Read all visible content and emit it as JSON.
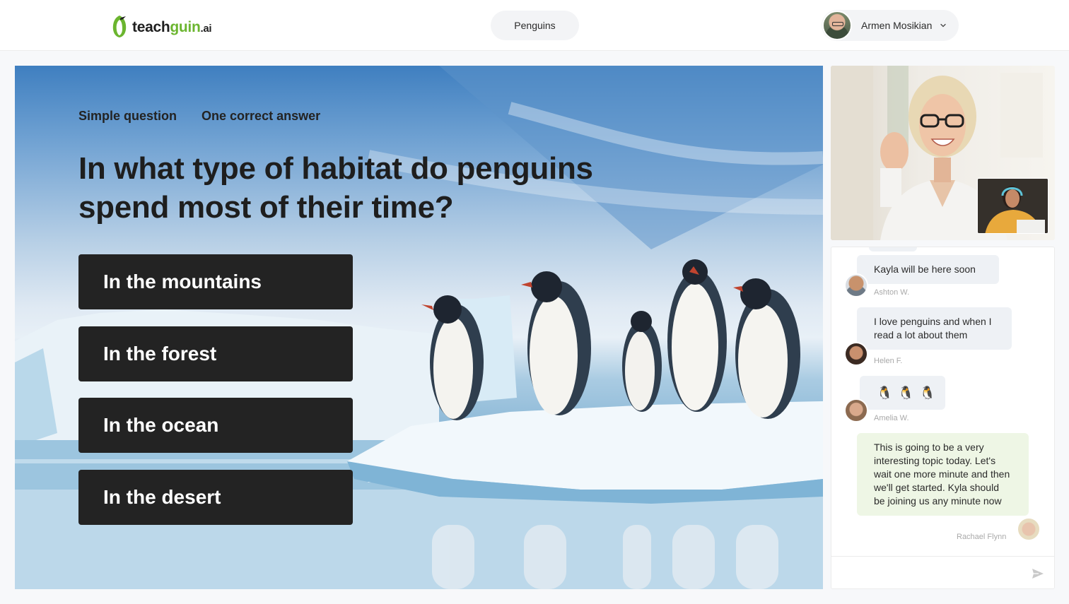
{
  "header": {
    "logo": {
      "part1": "teach",
      "part2": "guin",
      "part3": ".ai",
      "icon": "penguin-logo-icon"
    },
    "topic": "Penguins",
    "user": {
      "name": "Armen Mosikian",
      "menu_icon": "chevron-down-icon"
    }
  },
  "quiz": {
    "type_label": "Simple question",
    "mode_label": "One correct answer",
    "question": "In what type of habitat do penguins spend most of their time?",
    "answers": [
      "In the mountains",
      "In the forest",
      "In the ocean",
      "In the desert"
    ]
  },
  "video": {
    "main_feed_icon": "video-feed",
    "pip_feed_icon": "self-view-feed"
  },
  "chat": {
    "messages": [
      {
        "text": "Kayla will be here soon",
        "sender": "Ashton W."
      },
      {
        "text": "I love penguins and when I read a lot about them",
        "sender": "Helen F."
      },
      {
        "emojis": [
          "🐧",
          "🐧",
          "🐧"
        ],
        "sender": "Amelia W."
      },
      {
        "text": "This is going to be a very interesting topic today. Let's wait one more minute and then we'll get started. Kyla should be joining us any minute now",
        "sender": "Rachael Flynn",
        "own": true
      }
    ],
    "input_placeholder": "",
    "send_icon": "send-icon"
  },
  "colors": {
    "brand_green": "#6bb52f",
    "answer_bg": "#232323",
    "bubble_other": "#eef1f5",
    "bubble_own": "#eef6e5"
  }
}
